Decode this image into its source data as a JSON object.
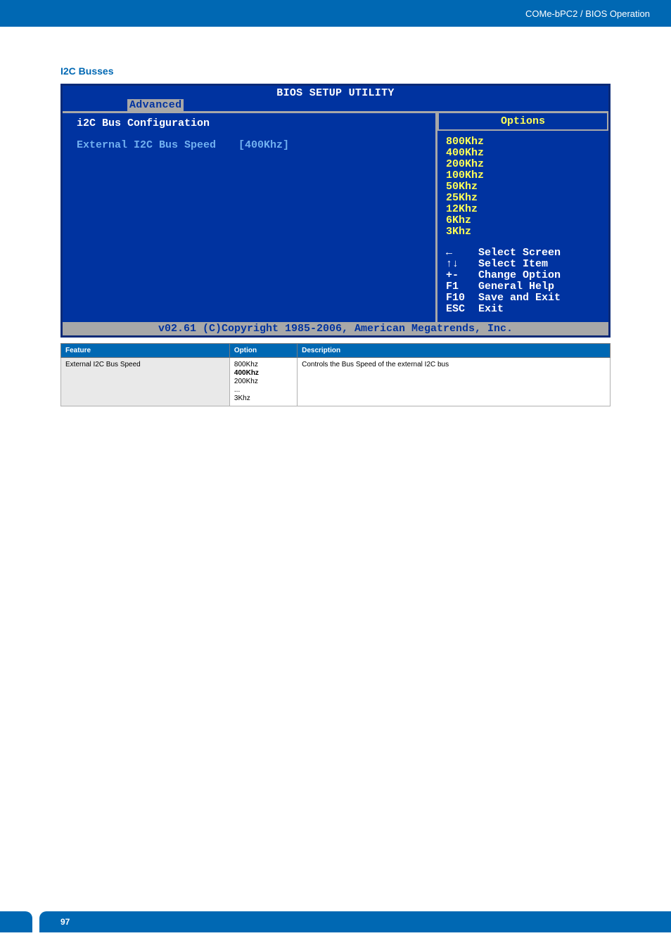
{
  "header": {
    "breadcrumb": "COMe-bPC2 / BIOS Operation"
  },
  "section_heading": "I2C Busses",
  "bios": {
    "title": "BIOS SETUP UTILITY",
    "active_tab": "Advanced",
    "left": {
      "title": "i2C Bus Configuration",
      "item_label": "External I2C Bus Speed",
      "item_value": "[400Khz]"
    },
    "right": {
      "header": "Options",
      "options": [
        "800Khz",
        "400Khz",
        "200Khz",
        "100Khz",
        "50Khz",
        "25Khz",
        "12Khz",
        "6Khz",
        "3Khz"
      ],
      "hints": [
        {
          "key": "←",
          "label": "Select Screen"
        },
        {
          "key": "↑↓",
          "label": "Select Item"
        },
        {
          "key": "+-",
          "label": "Change Option"
        },
        {
          "key": "F1",
          "label": "General Help"
        },
        {
          "key": "F10",
          "label": "Save and Exit"
        },
        {
          "key": "ESC",
          "label": "Exit"
        }
      ]
    },
    "copyright": "v02.61 (C)Copyright 1985-2006, American Megatrends, Inc."
  },
  "table": {
    "headers": [
      "Feature",
      "Option",
      "Description"
    ],
    "rows": [
      {
        "feature": "External I2C Bus Speed",
        "option_lines": [
          "800Khz",
          "400Khz",
          "200Khz",
          "...",
          "3Khz"
        ],
        "option_bold_index": 1,
        "description": "Controls the Bus Speed of the external I2C bus"
      }
    ]
  },
  "footer": {
    "page": "97"
  }
}
